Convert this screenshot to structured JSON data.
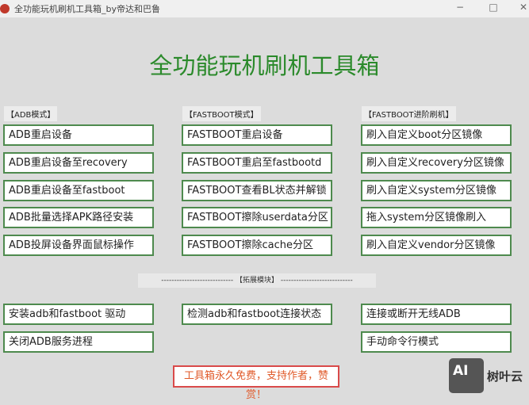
{
  "window": {
    "title": "全功能玩机刷机工具箱_by帝达和巴鲁",
    "minimize": "−",
    "maximize": "□",
    "close": "✕"
  },
  "heading": "全功能玩机刷机工具箱",
  "sections": [
    {
      "label": "【ADB模式】",
      "buttons": [
        "ADB重启设备",
        "ADB重启设备至recovery",
        "ADB重启设备至fastboot",
        "ADB批量选择APK路径安装",
        "ADB投屏设备界面鼠标操作"
      ]
    },
    {
      "label": "【FASTBOOT模式】",
      "buttons": [
        "FASTBOOT重启设备",
        "FASTBOOT重启至fastbootd",
        "FASTBOOT查看BL状态并解锁",
        "FASTBOOT擦除userdata分区",
        "FASTBOOT擦除cache分区"
      ]
    },
    {
      "label": "【FASTBOOT进阶刷机】",
      "buttons": [
        "刷入自定义boot分区镜像",
        "刷入自定义recovery分区镜像",
        "刷入自定义system分区镜像",
        "拖入system分区镜像刷入",
        "刷入自定义vendor分区镜像"
      ]
    }
  ],
  "separator": "---------------------------- 【拓展模块】 ----------------------------",
  "extensions": {
    "install_driver": "安装adb和fastboot 驱动",
    "check_connection": "检测adb和fastboot连接状态",
    "wireless_adb": "连接或断开无线ADB",
    "kill_adb": "关闭ADB服务进程",
    "cmd_mode": "手动命令行模式"
  },
  "donate": "工具箱永久免费，支持作者，赞赏！",
  "watermark": {
    "logo": "AI",
    "text": "树叶云"
  }
}
